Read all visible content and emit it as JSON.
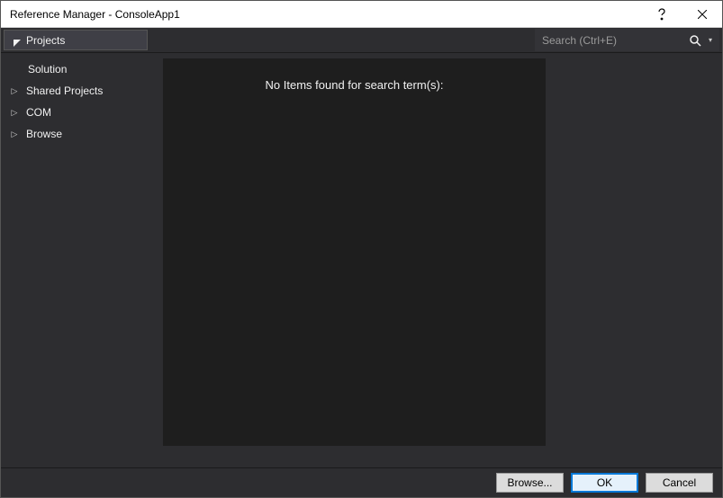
{
  "window": {
    "title": "Reference Manager - ConsoleApp1"
  },
  "toolbar": {
    "active_tab": "Projects",
    "search_placeholder": "Search (Ctrl+E)"
  },
  "sidebar": {
    "items": [
      {
        "label": "Solution",
        "sub": true,
        "expandable": false
      },
      {
        "label": "Shared Projects",
        "sub": false,
        "expandable": true
      },
      {
        "label": "COM",
        "sub": false,
        "expandable": true
      },
      {
        "label": "Browse",
        "sub": false,
        "expandable": true
      }
    ]
  },
  "main": {
    "empty_message": "No Items found for search term(s):"
  },
  "footer": {
    "browse": "Browse...",
    "ok": "OK",
    "cancel": "Cancel"
  }
}
